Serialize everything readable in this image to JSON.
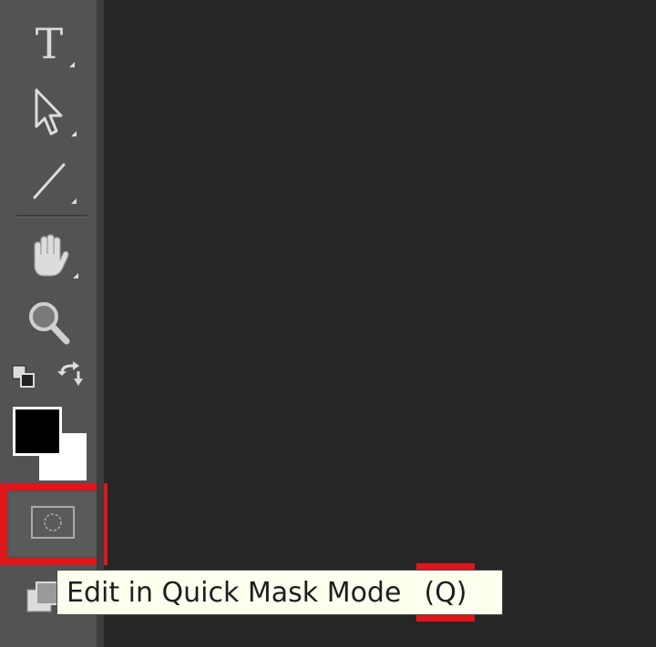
{
  "toolbar": {
    "tools": [
      {
        "id": "type-tool",
        "icon": "type-icon"
      },
      {
        "id": "path-selection-tool",
        "icon": "arrow-cursor-icon"
      },
      {
        "id": "line-tool",
        "icon": "line-icon"
      },
      {
        "id": "hand-tool",
        "icon": "hand-icon"
      },
      {
        "id": "zoom-tool",
        "icon": "magnifier-icon"
      }
    ],
    "type_glyph": "T",
    "foreground_color": "#000000",
    "background_color": "#ffffff",
    "quick_mask": {
      "icon": "quick-mask-icon"
    }
  },
  "tooltip": {
    "text": "Edit in Quick Mask Mode",
    "shortcut": "(Q)"
  },
  "colors": {
    "panel": "#535353",
    "canvas": "#262626",
    "highlight": "#e0161b",
    "tooltip_bg": "#fffff0"
  }
}
